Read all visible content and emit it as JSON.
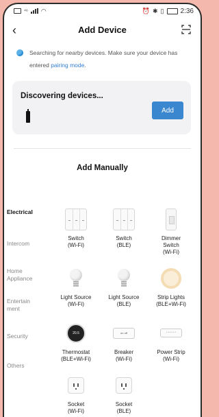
{
  "status": {
    "signal": "⁴⁶",
    "time": "2:36"
  },
  "header": {
    "title": "Add Device"
  },
  "info": {
    "text": "Searching for nearby devices. Make sure your device has entered ",
    "link": "pairing mode",
    "tail": "."
  },
  "discovering": {
    "title": "Discovering devices...",
    "add_label": "Add"
  },
  "manual": {
    "title": "Add Manually"
  },
  "categories": [
    "Electrical",
    "Intercom",
    "Home Appliance",
    "Entertainment",
    "Security",
    "Others"
  ],
  "devices": [
    {
      "name": "Switch",
      "sub": "(Wi-Fi)"
    },
    {
      "name": "Switch",
      "sub": "(BLE)"
    },
    {
      "name": "Dimmer Switch",
      "sub": "(Wi-Fi)"
    },
    {
      "name": "Light Source",
      "sub": "(Wi-Fi)"
    },
    {
      "name": "Light Source",
      "sub": "(BLE)"
    },
    {
      "name": "Strip Lights",
      "sub": "(BLE+Wi-Fi)"
    },
    {
      "name": "Thermostat",
      "sub": "(BLE+Wi-Fi)"
    },
    {
      "name": "Breaker",
      "sub": "(Wi-Fi)"
    },
    {
      "name": "Power Strip",
      "sub": "(Wi-Fi)"
    },
    {
      "name": "Socket",
      "sub": "(Wi-Fi)"
    },
    {
      "name": "Socket",
      "sub": "(BLE)"
    }
  ],
  "icon_text": {
    "thermostat": "20.5",
    "breaker": "on off"
  }
}
